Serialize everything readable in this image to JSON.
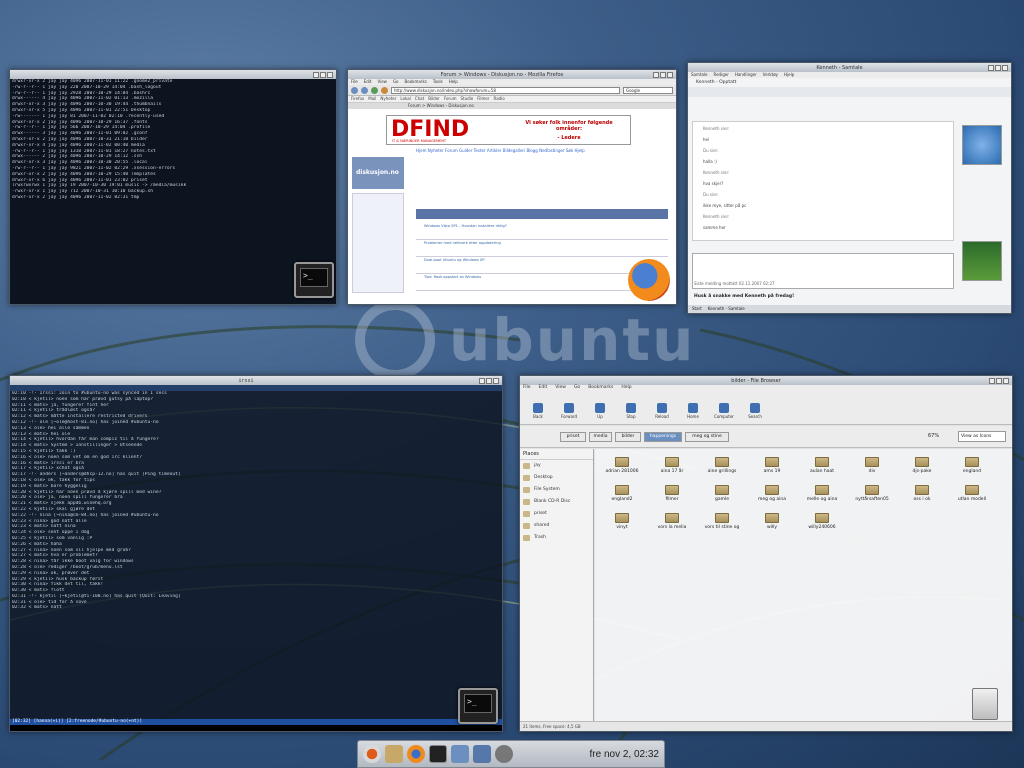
{
  "watermark": {
    "word": "ubuntu"
  },
  "term_top": {
    "title": "",
    "lines": [
      "drwxr-xr-x 2 jay jay 4096 2007-11-01 11:22 .gnome2_private",
      "-rw-r--r-- 1 jay jay  220 2007-10-29 14:04 .bash_logout",
      "-rw-r--r-- 1 jay jay 2928 2007-10-29 14:04 .bashrc",
      "drwx------ 4 jay jay 4096 2007-11-02 01:13 .mozilla",
      "drwxr-xr-x 3 jay jay 4096 2007-10-30 19:44 .thumbnails",
      "drwxr-xr-x 5 jay jay 4096 2007-11-01 22:51 Desktop",
      "-rw------- 1 jay jay   81 2007-11-02 02:10 .recently-used",
      "drwxr-xr-x 2 jay jay 4096 2007-10-29 16:37 .fonts",
      "-rw-r--r-- 1 jay jay  566 2007-10-29 14:04 .profile",
      "drwx------ 3 jay jay 4096 2007-11-01 09:02 .gconf",
      "drwxr-xr-x 2 jay jay 4096 2007-10-31 21:18 bilder",
      "drwxr-xr-x 4 jay jay 4096 2007-11-02 00:40 media",
      "-rw-r--r-- 1 jay jay 1310 2007-11-01 18:27 notes.txt",
      "drwx------ 2 jay jay 4096 2007-10-29 14:12 .ssh",
      "drwxr-xr-x 3 jay jay 4096 2007-10-30 20:55 .local",
      "-rw-r--r-- 1 jay jay 9821 2007-11-02 02:29 .xsession-errors",
      "drwxr-xr-x 2 jay jay 4096 2007-10-29 15:40 Templates",
      "drwxr-xr-x 6 jay jay 4096 2007-11-01 23:02 priset",
      "lrwxrwxrwx 1 jay jay   19 2007-10-30 19:01 music -> /media/musikk",
      "-rwxr-xr-x 1 jay jay  712 2007-10-31 10:10 backup.sh",
      "drwxr-xr-x 2 jay jay 4096 2007-11-02 02:31 tmp"
    ],
    "status": "hanna@ubuntu:~$"
  },
  "firefox": {
    "title": "Forum > Windows - Diskusjon.no - Mozilla Firefox",
    "menu": [
      "File",
      "Edit",
      "View",
      "Go",
      "Bookmarks",
      "Tools",
      "Help"
    ],
    "url": "http://www.diskusjon.no/index.php?showforum=58",
    "search": "Google",
    "bookmarks": [
      "Firefox",
      "Mail",
      "Nyheter",
      "Lokal",
      "Chat",
      "Bilder",
      "Forum",
      "Studie",
      "Filmer",
      "Radio"
    ],
    "tab": "Forum > Windows - Diskusjon.no",
    "ad_big": "DFIND",
    "ad_sub": "IT & NÆRINGER MANAGEMENT",
    "ad_right": "Vi søker folk innenfor følgende områder:",
    "ad_right2": "- Ledere",
    "nav": "Hjem  Nyheter  Forum  Guider  Tester  Artikler  Bildegalleri  Blogg  Nedlastinger  Søk  Hjelp",
    "site_logo": "diskusjon.no",
    "forum_rows": [
      "Windows Vista SP1 - Hvordan installere riktig?",
      "Problemer med nettverk etter oppdatering",
      "Dual-boot Ubuntu og Windows XP",
      "Tips: Rask oppstart av Windows"
    ]
  },
  "chat": {
    "title": "Kenneth - Samtale",
    "menu": [
      "Samtale",
      "Rediger",
      "Handlinger",
      "Verktøy",
      "Hjelp"
    ],
    "header": "Kenneth - Opptatt",
    "messages": [
      "Kenneth sier:",
      "hei",
      "Du sier:",
      "halla :)",
      "Kenneth sier:",
      "hva skjer?",
      "Du sier:",
      "ikke mye, sitter på pc",
      "Kenneth sier:",
      "samme her"
    ],
    "status": "Siste melding mottatt 02.11.2007 02:27",
    "footer": "Husk å snakke med Kenneth på fredag!",
    "taskbar": [
      "Start",
      "Kenneth - Samtale"
    ]
  },
  "irc": {
    "title": "irssi",
    "lines": [
      "02:10 -!- Irssi: Join to #ubuntu-no was synced in 1 secs",
      "02:10 < kjetil> noen som har prøvd gutsy på laptop?",
      "02:11 < mats> ja, fungerer fint her",
      "02:11 < kjetil> trådløst også?",
      "02:12 < mats> måtte installere restricted drivers",
      "02:12 -!- ole [~ole@host-81.no] has joined #ubuntu-no",
      "02:13 < ole> hei alle sammen",
      "02:13 < mats> hei ole",
      "02:14 < kjetil> hvordan får man compiz til å fungere?",
      "02:14 < mats> System > Innstillinger > Utseende",
      "02:15 < kjetil> takk :)",
      "02:16 < ole> noen som vet om en god irc klient?",
      "02:16 < mats> irssi er bra",
      "02:17 < kjetil> xchat også",
      "02:17 -!- anders [~anders@dhcp-12.no] has quit [Ping timeout]",
      "02:18 < ole> ok, takk for tips",
      "02:19 < mats> bare hyggelig",
      "02:20 < kjetil> har noen prøvd å kjøre spill med wine?",
      "02:20 < ole> ja, noen spill fungerer bra",
      "02:21 < mats> sjekk appdb.winehq.org",
      "02:22 < kjetil> skal gjøre det",
      "02:22 -!- nina [~nina@cm-84.no] has joined #ubuntu-no",
      "02:23 < nina> god natt alle",
      "02:23 < mats> natt nina",
      "02:24 < ole> sent oppe i dag",
      "02:25 < kjetil> som vanlig :P",
      "02:26 < mats> haha",
      "02:27 < nina> noen som vil hjelpe med grub?",
      "02:27 < mats> hva er problemet?",
      "02:28 < nina> får ikke boot valg for windows",
      "02:28 < ole> rediger /boot/grub/menu.lst",
      "02:29 < nina> ok, prøver det",
      "02:29 < kjetil> husk backup først",
      "02:30 < nina> fikk det til, takk!",
      "02:30 < mats> flott",
      "02:31 -!- kjetil [~kjetil@ti-100.no] has quit [Quit: Leaving]",
      "02:31 < ole> tid for å sove",
      "02:32 < mats> natt"
    ],
    "status": "[02:32] [hanna(+i)] [2:freenode/#ubuntu-no(+nt)]"
  },
  "filebrowser": {
    "title": "bilder - File Browser",
    "menu": [
      "File",
      "Edit",
      "View",
      "Go",
      "Bookmarks",
      "Help"
    ],
    "buttons": [
      "Back",
      "Forward",
      "Up",
      "Stop",
      "Reload",
      "Home",
      "Computer",
      "Search"
    ],
    "crumbs": [
      "priset",
      "media",
      "bilder",
      "happenings",
      "meg og stine"
    ],
    "zoom": "67%",
    "view": "View as Icons",
    "places_header": "Places",
    "places": [
      "jay",
      "Desktop",
      "File System",
      "Blank CD-R Disc",
      "priset",
      "shared",
      "Trash"
    ],
    "folders": [
      "adrian 281006",
      "aina 17 år",
      "aine grillings",
      "ams 19",
      "aulan haat",
      "div",
      "djs-pake",
      "england",
      "england2",
      "filmer",
      "gamle",
      "meg og aina",
      "melle og aina",
      "nyttårsaften05",
      "oss i ok",
      "utlan modell",
      "vinyt",
      "vors la melia",
      "vors til stine og",
      "willy",
      "willy240606"
    ],
    "status": "21 items, Free space: 4,5 GB"
  },
  "panel": {
    "clock": "fre nov  2, 02:32"
  }
}
